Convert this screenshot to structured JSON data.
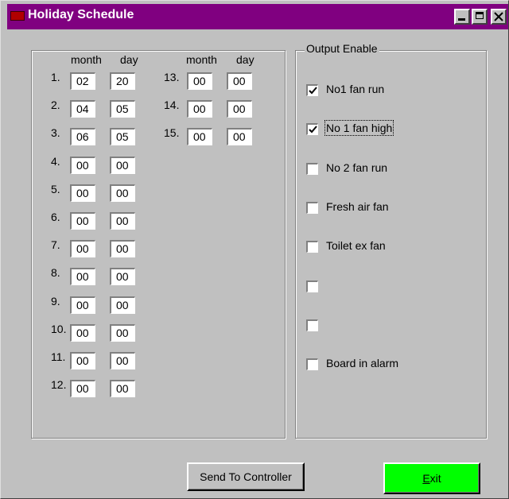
{
  "window": {
    "title": "Holiday Schedule"
  },
  "holidays": {
    "headers": {
      "month": "month",
      "day": "day"
    },
    "left": [
      {
        "num": "1.",
        "month": "02",
        "day": "20"
      },
      {
        "num": "2.",
        "month": "04",
        "day": "05"
      },
      {
        "num": "3.",
        "month": "06",
        "day": "05"
      },
      {
        "num": "4.",
        "month": "00",
        "day": "00"
      },
      {
        "num": "5.",
        "month": "00",
        "day": "00"
      },
      {
        "num": "6.",
        "month": "00",
        "day": "00"
      },
      {
        "num": "7.",
        "month": "00",
        "day": "00"
      },
      {
        "num": "8.",
        "month": "00",
        "day": "00"
      },
      {
        "num": "9.",
        "month": "00",
        "day": "00"
      },
      {
        "num": "10.",
        "month": "00",
        "day": "00"
      },
      {
        "num": "11.",
        "month": "00",
        "day": "00"
      },
      {
        "num": "12.",
        "month": "00",
        "day": "00"
      }
    ],
    "right": [
      {
        "num": "13.",
        "month": "00",
        "day": "00"
      },
      {
        "num": "14.",
        "month": "00",
        "day": "00"
      },
      {
        "num": "15.",
        "month": "00",
        "day": "00"
      }
    ]
  },
  "output": {
    "title": "Output Enable",
    "items": [
      {
        "label": "No1 fan run",
        "checked": true
      },
      {
        "label": "No 1 fan high",
        "checked": true
      },
      {
        "label": "No 2 fan run",
        "checked": false
      },
      {
        "label": "Fresh air fan",
        "checked": false
      },
      {
        "label": "Toilet ex fan",
        "checked": false
      },
      {
        "label": "",
        "checked": false
      },
      {
        "label": "",
        "checked": false
      },
      {
        "label": "Board in alarm",
        "checked": false
      }
    ]
  },
  "buttons": {
    "send": "Send To Controller",
    "exit_mnemonic": "E",
    "exit_rest": "xit"
  },
  "colors": {
    "title_bar": "#800080",
    "exit_button": "#00ff00",
    "face": "#c0c0c0"
  }
}
